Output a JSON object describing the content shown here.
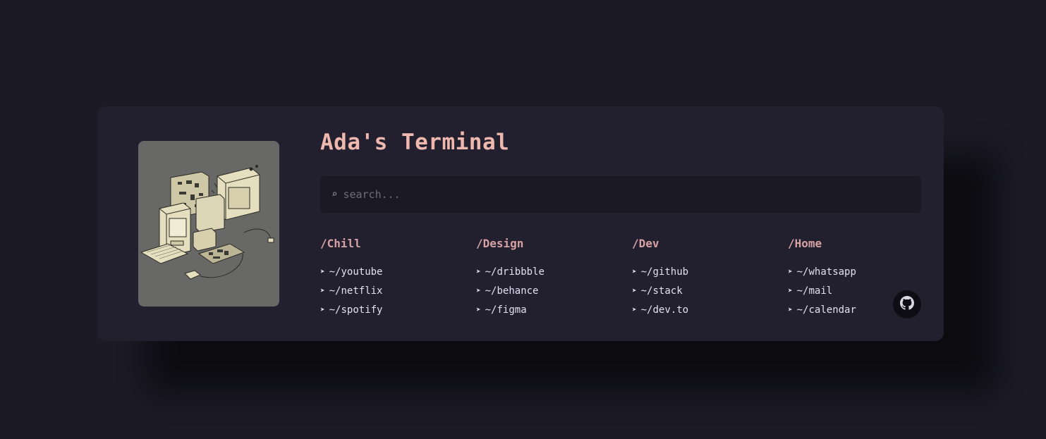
{
  "title": "Ada's Terminal",
  "search": {
    "placeholder": "search...",
    "icon": "search-icon"
  },
  "columns": [
    {
      "heading": "/Chill",
      "links": [
        "~/youtube",
        "~/netflix",
        "~/spotify"
      ]
    },
    {
      "heading": "/Design",
      "links": [
        "~/dribbble",
        "~/behance",
        "~/figma"
      ]
    },
    {
      "heading": "/Dev",
      "links": [
        "~/github",
        "~/stack",
        "~/dev.to"
      ]
    },
    {
      "heading": "/Home",
      "links": [
        "~/whatsapp",
        "~/mail",
        "~/calendar"
      ]
    }
  ],
  "link_arrow": "➤",
  "colors": {
    "page_bg": "#1b1a25",
    "card_bg": "#221f2f",
    "title": "#efb8ae",
    "heading": "#d7a2a4",
    "link": "#e3e1ef",
    "search_bg": "#1b1a24"
  },
  "github_button": {
    "icon": "github-icon"
  }
}
